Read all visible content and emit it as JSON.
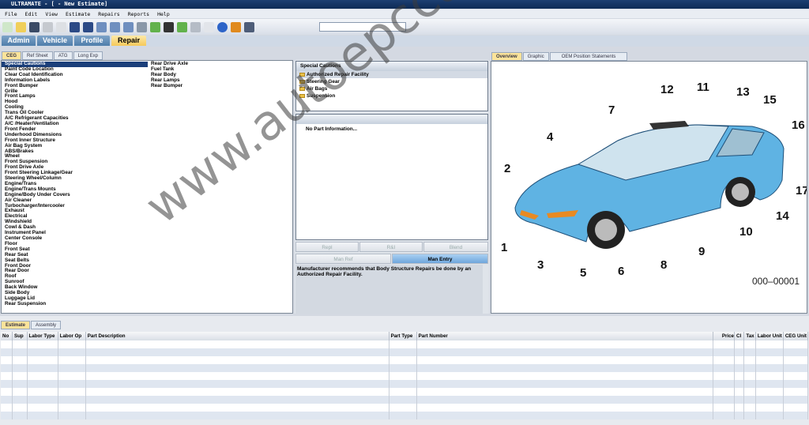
{
  "window": {
    "title": "ULTRAMATE - [ - New Estimate]"
  },
  "menu": [
    "File",
    "Edit",
    "View",
    "Estimate",
    "Repairs",
    "Reports",
    "Help"
  ],
  "main_tabs": [
    "Admin",
    "Vehicle",
    "Profile",
    "Repair"
  ],
  "main_active": "Repair",
  "left_tabs": [
    "CEG",
    "Ref Sheet",
    "ATG",
    "Long Exp"
  ],
  "ceg_list": [
    "Special Cautions",
    "Paint Code Location",
    "Clear Coat Identification",
    "Information Labels",
    "Front Bumper",
    "Grille",
    "Front Lamps",
    "Hood",
    "Cooling",
    "Trans Oil Cooler",
    "A/C Refrigerant Capacities",
    "A/C /Heater/Ventilation",
    "Front Fender",
    "Underhood Dimensions",
    "Front Inner Structure",
    "Air Bag System",
    "ABS/Brakes",
    "Wheel",
    "Front Suspension",
    "Front Drive Axle",
    "Front Steering Linkage/Gear",
    "Steering Wheel/Column",
    "Engine/Trans",
    "Engine/Trans Mounts",
    "Engine/Body Under Covers",
    "Air Cleaner",
    "Turbocharger/Intercooler",
    "Exhaust",
    "Electrical",
    "Windshield",
    "Cowl & Dash",
    "Instrument Panel",
    "Center Console",
    "Floor",
    "Front Seat",
    "Rear Seat",
    "Seat Belts",
    "Front Door",
    "Rear Door",
    "Roof",
    "Sunroof",
    "Back Window",
    "Side Body",
    "Luggage Lid",
    "Rear Suspension"
  ],
  "ceg_list_col2": [
    "Rear Drive Axle",
    "Fuel Tank",
    "Rear Body",
    "Rear Lamps",
    "Rear Bumper"
  ],
  "cautions": {
    "header": "Special Cautions",
    "items": [
      "Authorized Repair Facility",
      "Steering Gear",
      "Air Bags",
      "Suspension"
    ]
  },
  "part_info": {
    "header": "",
    "text": "No Part Information..."
  },
  "action_buttons": [
    "Repl",
    "R&I",
    "Blend",
    "Man Ref",
    "Man Entry"
  ],
  "note": "Manufacturer recommends that Body Structure Repairs be done by an Authorized Repair Facility.",
  "right_tabs": [
    "Overview",
    "Graphic",
    "OEM Position Statements"
  ],
  "diagram": {
    "callouts": [
      "1",
      "2",
      "3",
      "4",
      "5",
      "6",
      "7",
      "8",
      "9",
      "10",
      "11",
      "12",
      "13",
      "14",
      "15",
      "16",
      "17"
    ],
    "code": "000–00001",
    "body_color": "#5fb3e3"
  },
  "bottom_tabs": [
    "Estimate",
    "Assembly"
  ],
  "table_headers": [
    "No",
    "Sup",
    "Labor Type",
    "Labor Op",
    "Part Description",
    "Part Type",
    "Part Number",
    "Price",
    "Cl",
    "Tax",
    "Labor Unit",
    "CEG Unit"
  ],
  "watermark": "www.autoepccatalog.com"
}
